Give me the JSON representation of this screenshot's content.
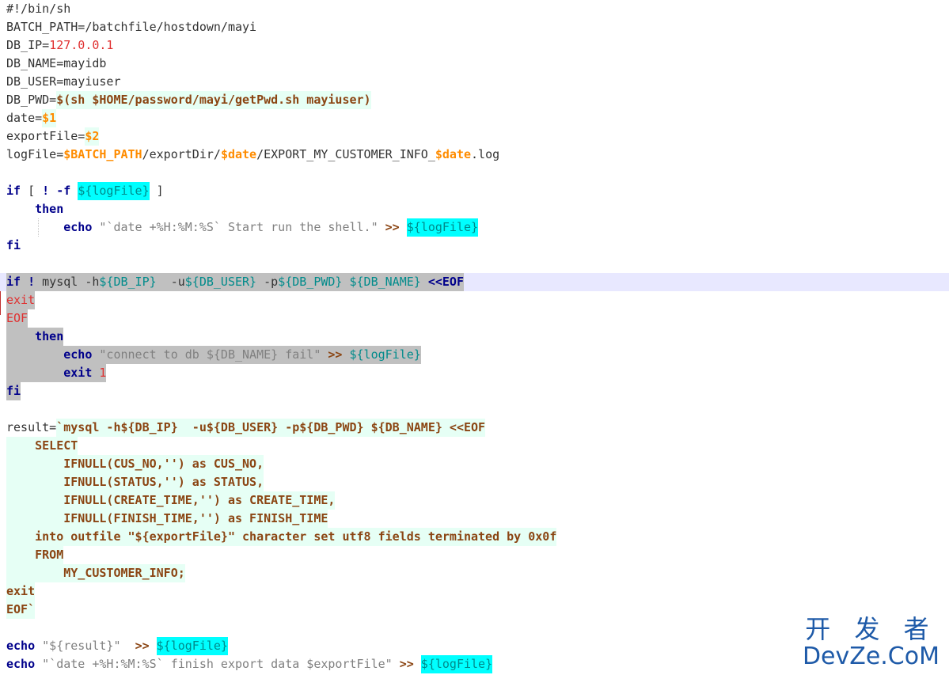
{
  "editor": {
    "lines": [
      [
        {
          "t": "#!/bin/sh",
          "c": "p"
        }
      ],
      [
        {
          "t": "BATCH_PATH=/batchfile/hostdown/mayi",
          "c": "p"
        }
      ],
      [
        {
          "t": "DB_IP=",
          "c": "p"
        },
        {
          "t": "127.0.0.1",
          "c": "r"
        }
      ],
      [
        {
          "t": "DB_NAME=mayidb",
          "c": "p"
        }
      ],
      [
        {
          "t": "DB_USER=mayiuser",
          "c": "p"
        }
      ],
      [
        {
          "t": "DB_PWD=",
          "c": "p"
        },
        {
          "t": "$(sh $HOME/password/mayi/getPwd.sh mayiuser)",
          "c": "b",
          "bg": "mint"
        }
      ],
      [
        {
          "t": "date=",
          "c": "p"
        },
        {
          "t": "$1",
          "c": "o",
          "bg": "mint"
        }
      ],
      [
        {
          "t": "exportFile=",
          "c": "p"
        },
        {
          "t": "$2",
          "c": "o",
          "bg": "mint"
        }
      ],
      [
        {
          "t": "logFile=",
          "c": "p"
        },
        {
          "t": "$BATCH_PATH",
          "c": "o"
        },
        {
          "t": "/exportDir/",
          "c": "p"
        },
        {
          "t": "$date",
          "c": "o"
        },
        {
          "t": "/EXPORT_MY_CUSTOMER_INFO_",
          "c": "p"
        },
        {
          "t": "$date",
          "c": "o"
        },
        {
          "t": ".log",
          "c": "p"
        }
      ],
      [],
      [
        {
          "t": "if",
          "c": "k"
        },
        {
          "t": " [ ",
          "c": "p"
        },
        {
          "t": "!",
          "c": "k"
        },
        {
          "t": " ",
          "c": "p"
        },
        {
          "t": "-f",
          "c": "k"
        },
        {
          "t": " ",
          "c": "p"
        },
        {
          "t": "${logFile}",
          "c": "t",
          "bg": "cyan"
        },
        {
          "t": " ]",
          "c": "p"
        }
      ],
      [
        {
          "t": "    ",
          "c": "p"
        },
        {
          "t": "then",
          "c": "k"
        }
      ],
      [
        {
          "t": "        ",
          "c": "p"
        },
        {
          "t": "echo",
          "c": "k"
        },
        {
          "t": " ",
          "c": "p"
        },
        {
          "t": "\"`date +%H:%M:%S` Start run the shell.\"",
          "c": "s"
        },
        {
          "t": " ",
          "c": "p"
        },
        {
          "t": ">>",
          "c": "b"
        },
        {
          "t": " ",
          "c": "p"
        },
        {
          "t": "${logFile}",
          "c": "t",
          "bg": "cyan"
        }
      ],
      [
        {
          "t": "fi",
          "c": "k"
        }
      ],
      [],
      [
        {
          "t": "if",
          "c": "k",
          "bg": "gray"
        },
        {
          "t": " ",
          "c": "p",
          "bg": "gray"
        },
        {
          "t": "!",
          "c": "k",
          "bg": "gray"
        },
        {
          "t": " mysql -h",
          "c": "p",
          "bg": "gray"
        },
        {
          "t": "${DB_IP}",
          "c": "t",
          "bg": "gray"
        },
        {
          "t": "  -u",
          "c": "p",
          "bg": "gray"
        },
        {
          "t": "${DB_USER}",
          "c": "t",
          "bg": "gray"
        },
        {
          "t": " -p",
          "c": "p",
          "bg": "gray"
        },
        {
          "t": "${DB_PWD}",
          "c": "t",
          "bg": "gray"
        },
        {
          "t": " ",
          "c": "p",
          "bg": "gray"
        },
        {
          "t": "${DB_NAME}",
          "c": "t",
          "bg": "gray"
        },
        {
          "t": " ",
          "c": "p",
          "bg": "gray"
        },
        {
          "t": "<<EOF",
          "c": "k",
          "bg": "gray"
        }
      ],
      [
        {
          "t": "exit",
          "c": "r",
          "bg": "gray"
        }
      ],
      [
        {
          "t": "EOF",
          "c": "r",
          "bg": "gray"
        }
      ],
      [
        {
          "t": "    ",
          "c": "p",
          "bg": "gray"
        },
        {
          "t": "then",
          "c": "k",
          "bg": "gray"
        }
      ],
      [
        {
          "t": "        ",
          "c": "p",
          "bg": "gray"
        },
        {
          "t": "echo",
          "c": "k",
          "bg": "gray"
        },
        {
          "t": " ",
          "c": "p",
          "bg": "gray"
        },
        {
          "t": "\"connect to db ${DB_NAME} fail\"",
          "c": "s",
          "bg": "gray"
        },
        {
          "t": " ",
          "c": "p",
          "bg": "gray"
        },
        {
          "t": ">>",
          "c": "b",
          "bg": "gray"
        },
        {
          "t": " ",
          "c": "p",
          "bg": "gray"
        },
        {
          "t": "${logFile}",
          "c": "t",
          "bg": "gray"
        }
      ],
      [
        {
          "t": "        ",
          "c": "p",
          "bg": "gray"
        },
        {
          "t": "exit",
          "c": "k",
          "bg": "gray"
        },
        {
          "t": " ",
          "c": "p",
          "bg": "gray"
        },
        {
          "t": "1",
          "c": "r",
          "bg": "gray"
        }
      ],
      [
        {
          "t": "fi",
          "c": "k",
          "bg": "gray"
        }
      ],
      [],
      [
        {
          "t": "result=",
          "c": "p"
        },
        {
          "t": "`mysql -h${DB_IP}  -u${DB_USER} -p${DB_PWD} ${DB_NAME} <<EOF",
          "c": "b",
          "bg": "mint"
        }
      ],
      [
        {
          "t": "    SELECT",
          "c": "b",
          "bg": "mint"
        }
      ],
      [
        {
          "t": "        IFNULL(CUS_NO,'') as CUS_NO,",
          "c": "b",
          "bg": "mint"
        }
      ],
      [
        {
          "t": "        IFNULL(STATUS,'') as STATUS,",
          "c": "b",
          "bg": "mint"
        }
      ],
      [
        {
          "t": "        IFNULL(CREATE_TIME,'') as CREATE_TIME,",
          "c": "b",
          "bg": "mint"
        }
      ],
      [
        {
          "t": "        IFNULL(FINISH_TIME,'') as FINISH_TIME",
          "c": "b",
          "bg": "mint"
        }
      ],
      [
        {
          "t": "    into outfile \"${exportFile}\" character set utf8 fields terminated by 0x0f",
          "c": "b",
          "bg": "mint"
        }
      ],
      [
        {
          "t": "    FROM",
          "c": "b",
          "bg": "mint"
        }
      ],
      [
        {
          "t": "        MY_CUSTOMER_INFO;",
          "c": "b",
          "bg": "mint"
        }
      ],
      [
        {
          "t": "exit",
          "c": "b",
          "bg": "mint"
        }
      ],
      [
        {
          "t": "EOF`",
          "c": "b",
          "bg": "mint"
        }
      ],
      [],
      [
        {
          "t": "echo",
          "c": "k"
        },
        {
          "t": " ",
          "c": "p"
        },
        {
          "t": "\"${result}\"",
          "c": "s"
        },
        {
          "t": "  ",
          "c": "p"
        },
        {
          "t": ">>",
          "c": "b"
        },
        {
          "t": " ",
          "c": "p"
        },
        {
          "t": "${logFile}",
          "c": "t",
          "bg": "cyan"
        }
      ],
      [
        {
          "t": "echo",
          "c": "k"
        },
        {
          "t": " ",
          "c": "p"
        },
        {
          "t": "\"`date +%H:%M:%S` finish export data $exportFile\"",
          "c": "s"
        },
        {
          "t": " ",
          "c": "p"
        },
        {
          "t": ">>",
          "c": "b"
        },
        {
          "t": " ",
          "c": "p"
        },
        {
          "t": "${logFile}",
          "c": "t",
          "bg": "cyan"
        }
      ]
    ],
    "current_line": 15
  },
  "watermark": {
    "line1": "开 发 者",
    "line2": "DevZe.CoM"
  },
  "colors": {
    "keyword": "#00008b",
    "number": "#e03030",
    "variable": "#ff8c00",
    "command_sub": "#8b4513",
    "string": "#808080",
    "var_ref": "#008b8b",
    "selection": "#c0c0c0",
    "heredoc_bg": "#e6fff5",
    "match_highlight": "#00ffff",
    "current_line": "#e8e8ff",
    "watermark": "#1e5aa8"
  }
}
